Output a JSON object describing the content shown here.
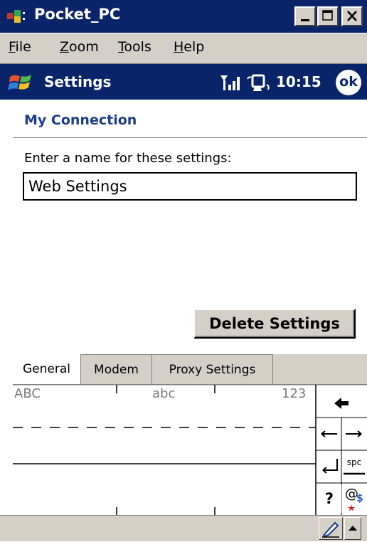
{
  "window": {
    "title": "Pocket_PC",
    "controls": {
      "minimize": "minimize",
      "maximize": "maximize",
      "close": "close"
    }
  },
  "menubar": [
    {
      "accel": "F",
      "rest": "ile"
    },
    {
      "accel": "Z",
      "rest": "oom"
    },
    {
      "accel": "T",
      "rest": "ools"
    },
    {
      "accel": "H",
      "rest": "elp"
    }
  ],
  "navbar": {
    "title": "Settings",
    "time": "10:15",
    "ok_label": "ok",
    "icons": [
      "windows-start-icon",
      "signal-icon",
      "phone-icon"
    ]
  },
  "content": {
    "header": "My Connection",
    "name_label": "Enter a name for these settings:",
    "name_value": "Web Settings",
    "delete_button": "Delete Settings"
  },
  "tabs": [
    {
      "label": "General",
      "active": true
    },
    {
      "label": "Modem",
      "active": false
    },
    {
      "label": "Proxy Settings",
      "active": false
    }
  ],
  "input_panel": {
    "zones": [
      "ABC",
      "abc",
      "123"
    ],
    "keys": {
      "space": "spc",
      "help": "?",
      "symbols": "@",
      "symbols_sub": "$"
    }
  },
  "colors": {
    "title_bar": "#0a246a",
    "header_text": "#1c3d8c",
    "chrome": "#d4d0c8"
  }
}
